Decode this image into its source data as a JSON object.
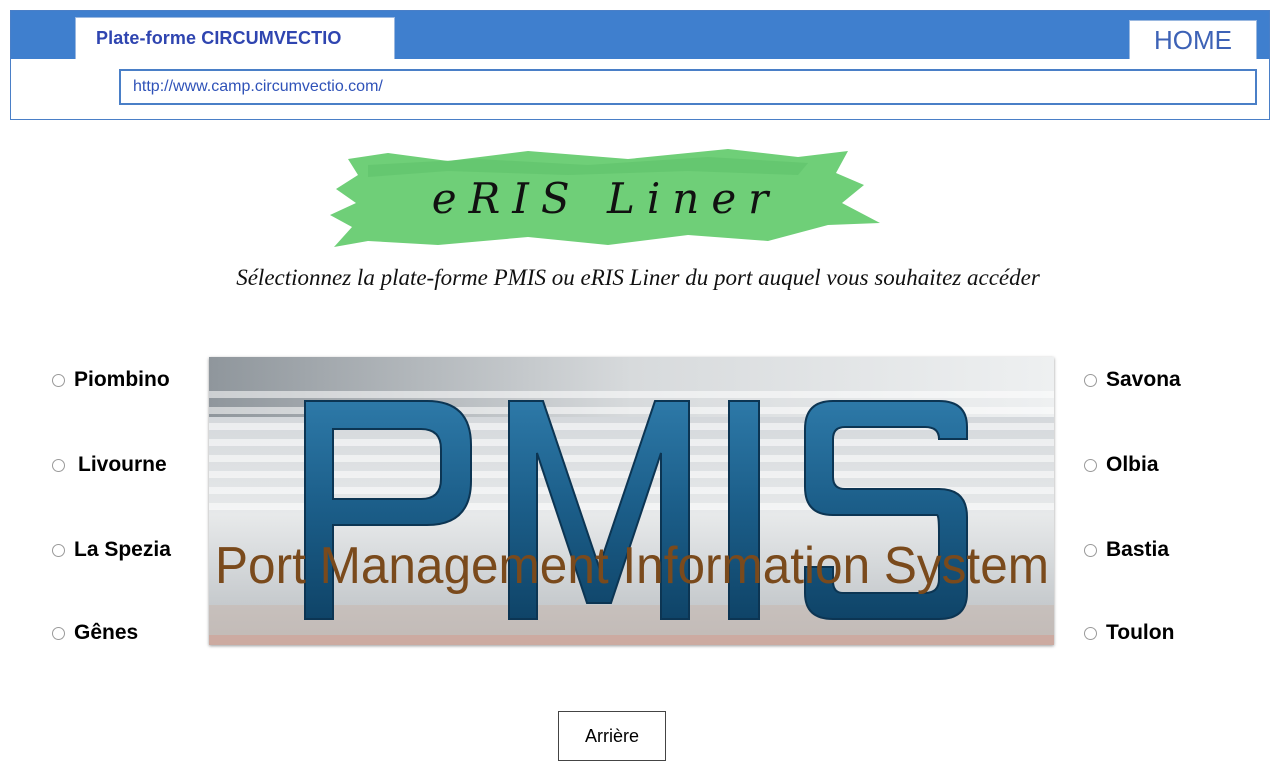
{
  "header": {
    "tab_title": "Plate-forme  CIRCUMVECTIO",
    "home_label": "HOME",
    "url": "http://www.camp.circumvectio.com/"
  },
  "logo": {
    "text": "eRIS Liner"
  },
  "instruction": "Sélectionnez la plate-forme PMIS ou eRIS Liner du port auquel vous souhaitez accéder",
  "ports_left": [
    "Piombino",
    "Livourne",
    "La Spezia",
    "Gênes"
  ],
  "ports_right": [
    "Savona",
    "Olbia",
    "Bastia",
    "Toulon"
  ],
  "pmis_image": {
    "big_text": "PMIS",
    "caption": "Port Management Information System"
  },
  "back_label": "Arrière",
  "colors": {
    "header_blue": "#3f7fce",
    "logo_green": "#6fcf78",
    "pmis_letters": "#1c5f8c",
    "caption_brown": "#7a4a1c"
  }
}
